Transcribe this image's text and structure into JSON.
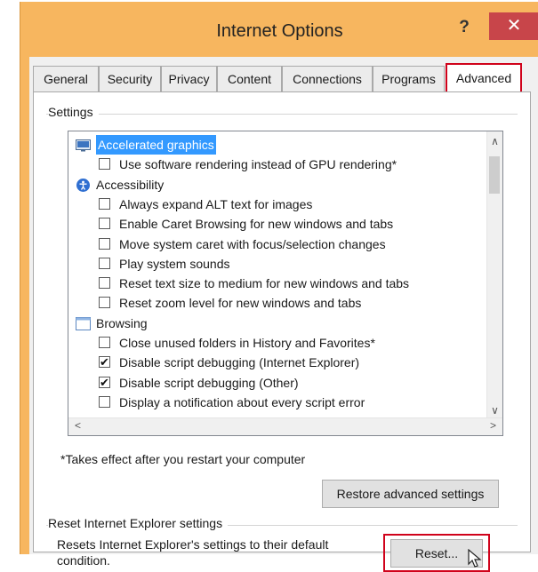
{
  "window": {
    "title": "Internet Options",
    "help_label": "?",
    "close_label": "✕"
  },
  "tabs": [
    {
      "label": "General"
    },
    {
      "label": "Security"
    },
    {
      "label": "Privacy"
    },
    {
      "label": "Content"
    },
    {
      "label": "Connections"
    },
    {
      "label": "Programs"
    },
    {
      "label": "Advanced",
      "active": true
    }
  ],
  "settings": {
    "group_label": "Settings",
    "items": [
      {
        "type": "category",
        "icon": "accelerated-graphics-icon",
        "label": "Accelerated graphics",
        "selected": true
      },
      {
        "type": "checkbox",
        "checked": false,
        "label": "Use software rendering instead of GPU rendering*"
      },
      {
        "type": "category",
        "icon": "accessibility-icon",
        "label": "Accessibility"
      },
      {
        "type": "checkbox",
        "checked": false,
        "label": "Always expand ALT text for images"
      },
      {
        "type": "checkbox",
        "checked": false,
        "label": "Enable Caret Browsing for new windows and tabs"
      },
      {
        "type": "checkbox",
        "checked": false,
        "label": "Move system caret with focus/selection changes"
      },
      {
        "type": "checkbox",
        "checked": false,
        "label": "Play system sounds"
      },
      {
        "type": "checkbox",
        "checked": false,
        "label": "Reset text size to medium for new windows and tabs"
      },
      {
        "type": "checkbox",
        "checked": false,
        "label": "Reset zoom level for new windows and tabs"
      },
      {
        "type": "category",
        "icon": "browsing-icon",
        "label": "Browsing"
      },
      {
        "type": "checkbox",
        "checked": false,
        "label": "Close unused folders in History and Favorites*"
      },
      {
        "type": "checkbox",
        "checked": true,
        "label": "Disable script debugging (Internet Explorer)"
      },
      {
        "type": "checkbox",
        "checked": true,
        "label": "Disable script debugging (Other)"
      },
      {
        "type": "checkbox",
        "checked": false,
        "label": "Display a notification about every script error"
      }
    ],
    "note": "*Takes effect after you restart your computer",
    "restore_label": "Restore advanced settings"
  },
  "reset_section": {
    "group_label": "Reset Internet Explorer settings",
    "description_line1": "Resets Internet Explorer's settings to their default",
    "description_line2": "condition.",
    "reset_label": "Reset..."
  }
}
